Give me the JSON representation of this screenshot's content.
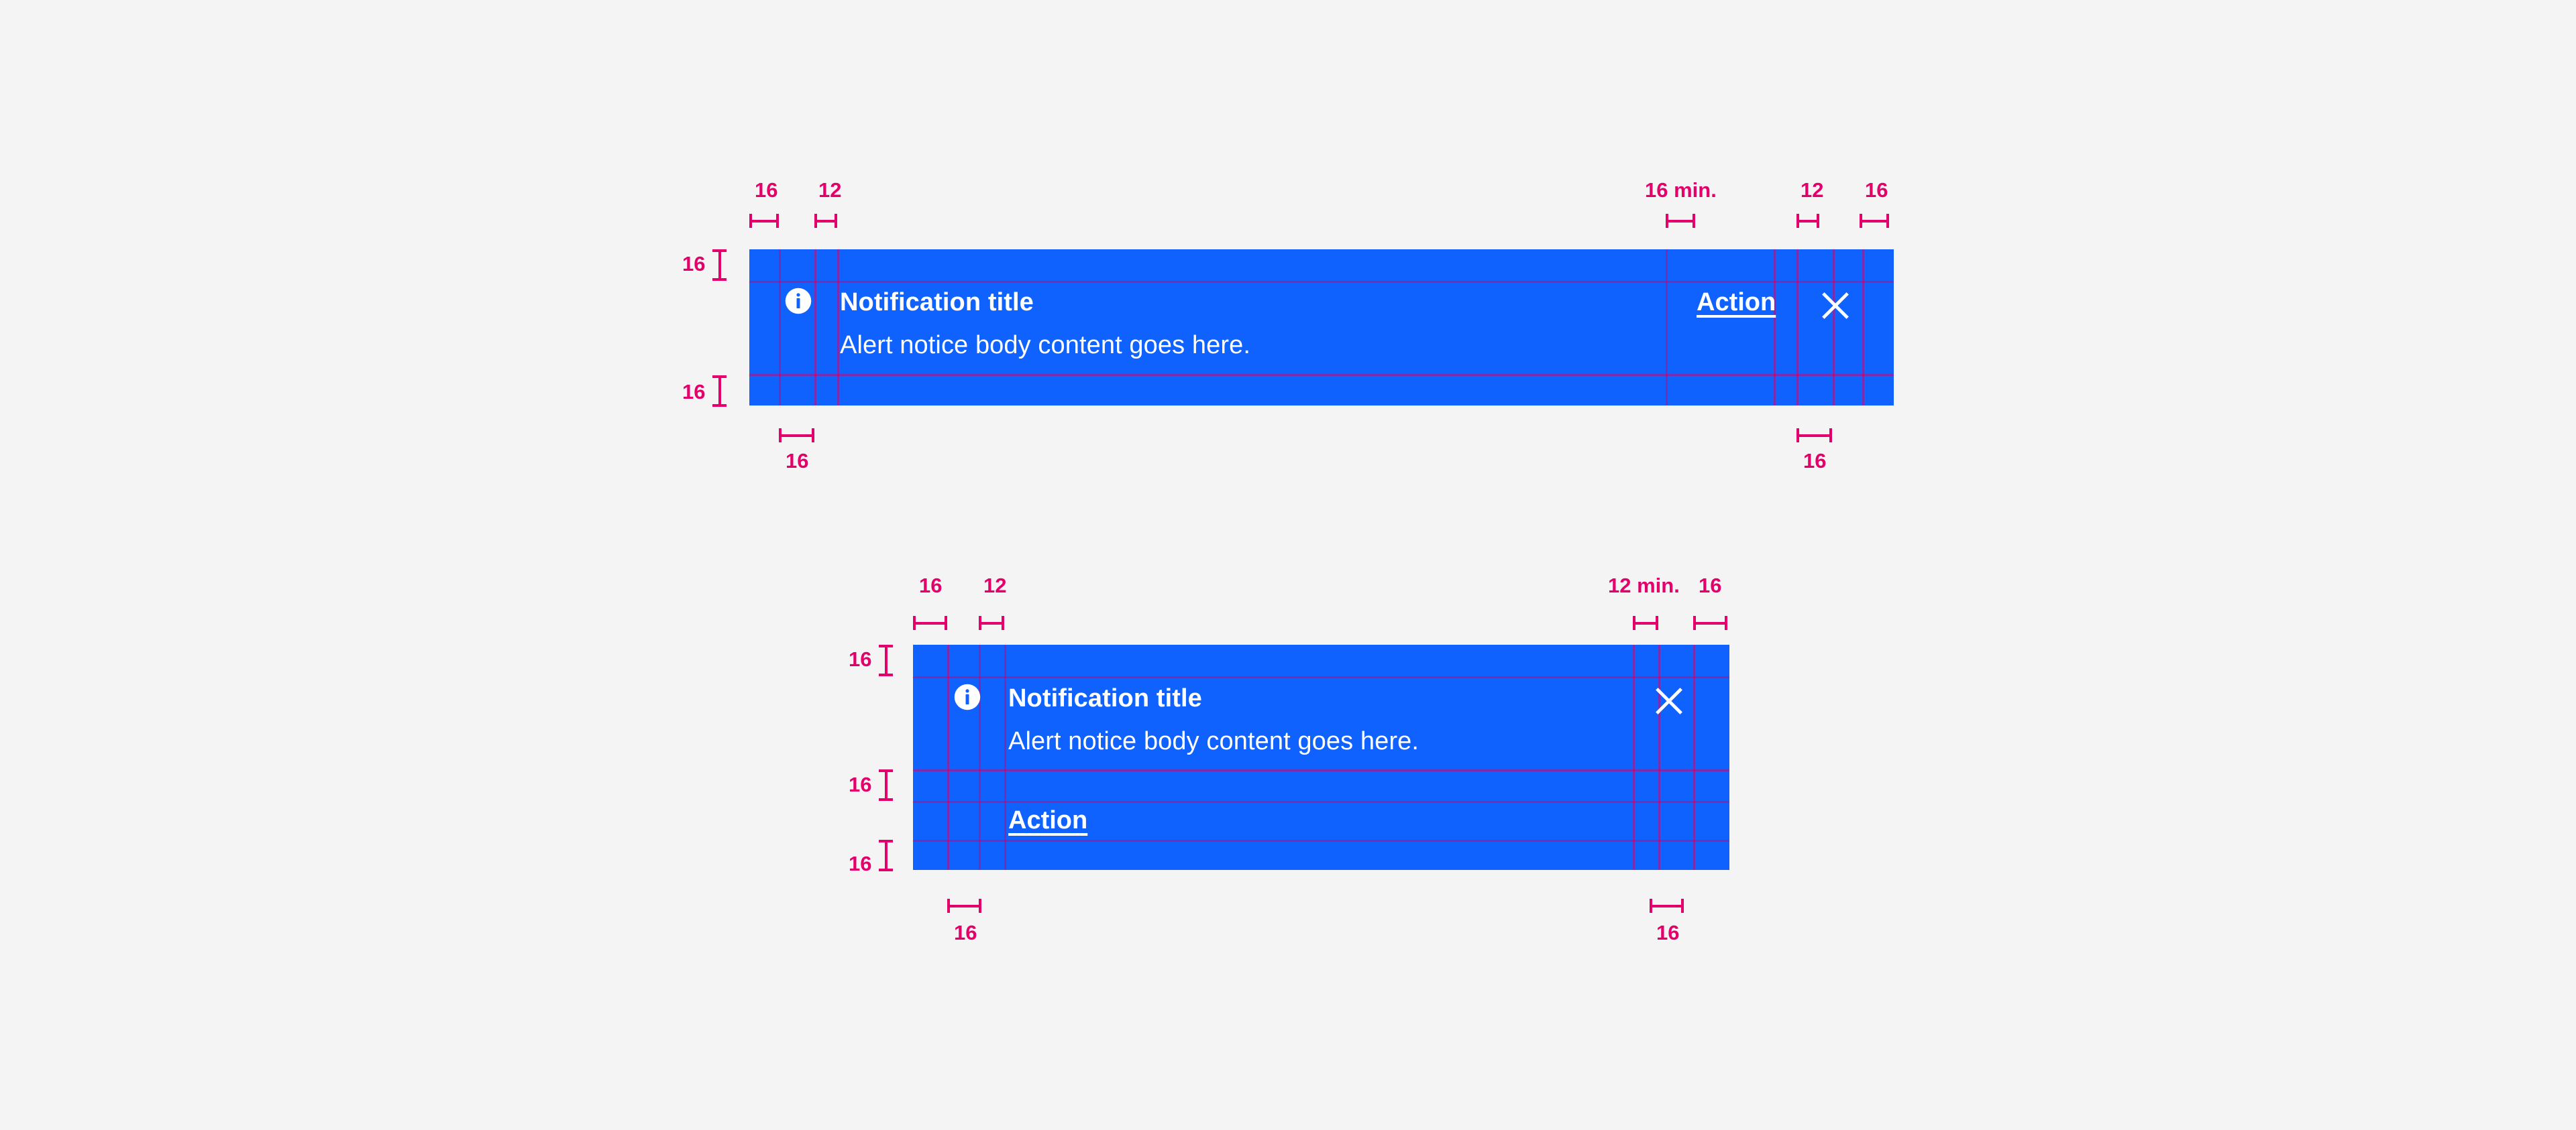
{
  "page": {
    "background_color": "#f4f4f4",
    "accent_blue": "#0f62fe",
    "annotation_pink": "#e4006b",
    "grid_line_color": "rgba(214,0,110,0.55)",
    "text_color": "#ffffff"
  },
  "notifications": [
    {
      "id": "inline-notification-single-line",
      "title": "Notification title",
      "body": "Alert notice body content goes here.",
      "action_label": "Action",
      "close_label": "close",
      "icon": "info-icon"
    },
    {
      "id": "inline-notification-stacked-action",
      "title": "Notification title",
      "body": "Alert notice body content goes here.",
      "action_label": "Action",
      "close_label": "close",
      "icon": "info-icon"
    }
  ],
  "annotations": {
    "notification_1": {
      "top_left_1": "16",
      "top_left_2": "12",
      "top_right_1": "16 min.",
      "top_right_2": "12",
      "top_right_3": "16",
      "left_top": "16",
      "left_bottom": "16",
      "bottom_left": "16",
      "bottom_right": "16"
    },
    "notification_2": {
      "top_left_1": "16",
      "top_left_2": "12",
      "top_right_1": "12 min.",
      "top_right_2": "16",
      "left_top": "16",
      "left_middle": "16",
      "left_bottom": "16",
      "bottom_left": "16",
      "bottom_right": "16"
    }
  }
}
